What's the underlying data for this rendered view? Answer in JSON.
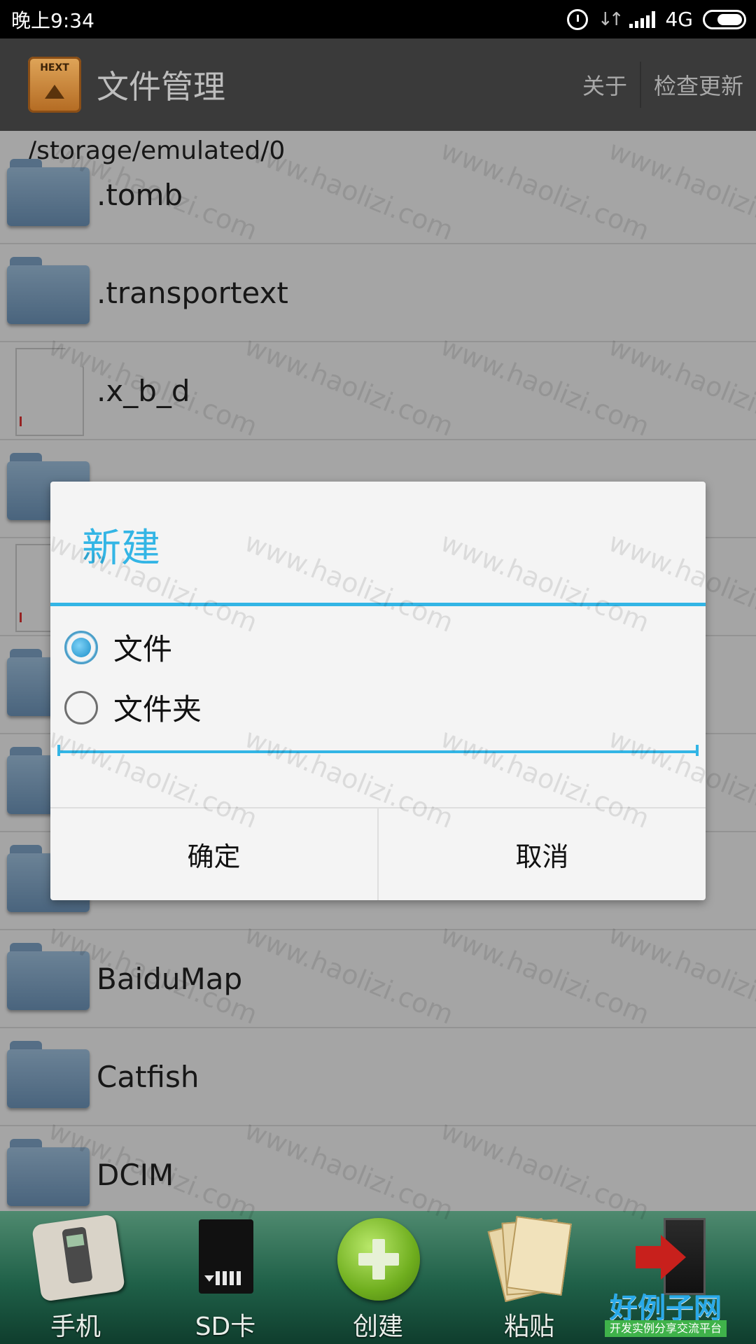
{
  "status_bar": {
    "time": "晚上9:34",
    "network": "4G"
  },
  "app_bar": {
    "logo_text": "HEXT",
    "title": "文件管理",
    "actions": {
      "about": "关于",
      "check_update": "检查更新"
    }
  },
  "file_list": {
    "path": "/storage/emulated/0",
    "items": [
      {
        "name": ".tomb",
        "type": "folder"
      },
      {
        "name": ".transportext",
        "type": "folder"
      },
      {
        "name": ".x_b_d",
        "type": "file"
      },
      {
        "name": "",
        "type": "folder"
      },
      {
        "name": "",
        "type": "file"
      },
      {
        "name": "",
        "type": "folder"
      },
      {
        "name": "",
        "type": "folder"
      },
      {
        "name": "",
        "type": "folder"
      },
      {
        "name": "BaiduMap",
        "type": "folder"
      },
      {
        "name": "Catfish",
        "type": "folder"
      },
      {
        "name": "DCIM",
        "type": "folder"
      }
    ]
  },
  "dialog": {
    "title": "新建",
    "options": [
      {
        "label": "文件",
        "checked": true
      },
      {
        "label": "文件夹",
        "checked": false
      }
    ],
    "input_value": "",
    "confirm": "确定",
    "cancel": "取消"
  },
  "toolbar": {
    "items": [
      {
        "label": "手机",
        "icon": "phone-icon"
      },
      {
        "label": "SD卡",
        "icon": "sd-card-icon"
      },
      {
        "label": "创建",
        "icon": "create-plus-icon"
      },
      {
        "label": "粘贴",
        "icon": "paste-icon"
      },
      {
        "label": "",
        "icon": "exit-icon"
      }
    ]
  },
  "watermark": "www.haolizi.com",
  "brand": {
    "title": "好例子网",
    "subtitle": "开发实例分享交流平台"
  },
  "colors": {
    "accent": "#33b5e5",
    "app_bar": "#3a3a3a",
    "toolbar": "#1f6048"
  }
}
